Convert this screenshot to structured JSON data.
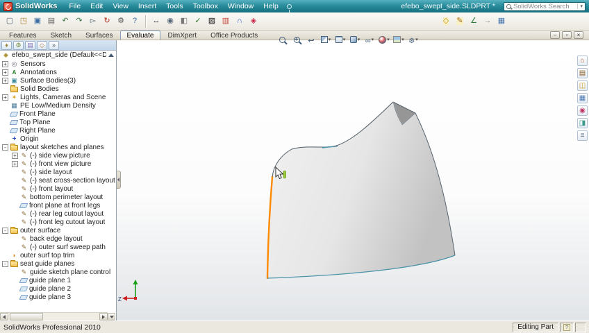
{
  "colors": {
    "titlebar": "#2a8d9c",
    "accent_orange": "#ff8a00",
    "edge_teal": "#4a93a8",
    "surface_light": "#f1f1f1",
    "surface_dark": "#c2c2c2",
    "flap_gray": "#969696",
    "toolbar_bg": "#ebe8e0",
    "status_bg": "#ebe8e0",
    "panel_header": "#d8e6f4"
  },
  "titlebar": {
    "app_name": "SolidWorks",
    "document_title": "efebo_swept_side.SLDPRT *",
    "search_placeholder": "SolidWorks Search",
    "menus": [
      {
        "label": "File",
        "name": "menu-file"
      },
      {
        "label": "Edit",
        "name": "menu-edit"
      },
      {
        "label": "View",
        "name": "menu-view"
      },
      {
        "label": "Insert",
        "name": "menu-insert"
      },
      {
        "label": "Tools",
        "name": "menu-tools"
      },
      {
        "label": "Toolbox",
        "name": "menu-toolbox"
      },
      {
        "label": "Window",
        "name": "menu-window"
      },
      {
        "label": "Help",
        "name": "menu-help"
      }
    ]
  },
  "toolbar": {
    "standard": [
      {
        "name": "new-button",
        "glyph": "▢",
        "fg": "#556677"
      },
      {
        "name": "open-button",
        "glyph": "◳",
        "fg": "#b08030"
      },
      {
        "name": "save-button",
        "glyph": "▣",
        "fg": "#3a6ea5"
      },
      {
        "name": "print-button",
        "glyph": "▤",
        "fg": "#666666"
      },
      {
        "name": "undo-button",
        "glyph": "↶",
        "fg": "#3a7a4a"
      },
      {
        "name": "redo-button",
        "glyph": "↷",
        "fg": "#3a7a4a"
      },
      {
        "name": "select-button",
        "glyph": "▻",
        "fg": "#556677"
      },
      {
        "name": "rebuild-button",
        "glyph": "↻",
        "fg": "#b03020"
      },
      {
        "name": "options-button",
        "glyph": "⚙",
        "fg": "#555555"
      },
      {
        "name": "help-button",
        "glyph": "?",
        "fg": "#3a6ea5"
      }
    ],
    "evaluate": [
      {
        "name": "measure-button",
        "glyph": "↔",
        "fg": "#333344"
      },
      {
        "name": "mass-properties-button",
        "glyph": "◉",
        "fg": "#556677"
      },
      {
        "name": "section-properties-button",
        "glyph": "◧",
        "fg": "#767676"
      },
      {
        "name": "check-entity-button",
        "glyph": "✓",
        "fg": "#2a7a2a"
      },
      {
        "name": "zebra-stripes-button",
        "glyph": "▨",
        "fg": "#111111"
      },
      {
        "name": "draft-analysis-button",
        "glyph": "▥",
        "fg": "#c04030"
      },
      {
        "name": "curvature-button",
        "glyph": "∩",
        "fg": "#3060c0"
      },
      {
        "name": "material-properties-button",
        "glyph": "◈",
        "fg": "#cc2244"
      }
    ],
    "sketch_group": [
      {
        "name": "reference-geometry-button",
        "glyph": "◇",
        "fg": "#b89010",
        "bg": "#faf0c4"
      },
      {
        "name": "sketch-button",
        "glyph": "✎",
        "fg": "#a06a20",
        "bg": "#faf0c4"
      },
      {
        "name": "smart-dimension-button",
        "glyph": "∠",
        "fg": "#2a7a3a"
      },
      {
        "name": "move-copy-button",
        "glyph": "→",
        "fg": "#888888"
      },
      {
        "name": "display-settings-button",
        "glyph": "▦",
        "fg": "#4a78b0"
      }
    ]
  },
  "command_tabs": [
    {
      "label": "Features",
      "name": "tab-features"
    },
    {
      "label": "Sketch",
      "name": "tab-sketch"
    },
    {
      "label": "Surfaces",
      "name": "tab-surfaces"
    },
    {
      "label": "Evaluate",
      "name": "tab-evaluate",
      "active": true
    },
    {
      "label": "DimXpert",
      "name": "tab-dimxpert"
    },
    {
      "label": "Office Products",
      "name": "tab-office-products"
    }
  ],
  "feature_tree": {
    "panel_tabs": [
      {
        "name": "featuremanager-tab",
        "glyph": "♦",
        "fg": "#9a8a3a"
      },
      {
        "name": "propertymanager-tab",
        "glyph": "⚙",
        "fg": "#6a8a3a"
      },
      {
        "name": "configurationmanager-tab",
        "glyph": "▤",
        "fg": "#7a6ab0"
      },
      {
        "name": "dimxpertmanager-tab",
        "glyph": "◇",
        "fg": "#b06a2a"
      },
      {
        "name": "panel-tabs-overflow",
        "glyph": "»",
        "fg": "#445566"
      }
    ],
    "root": "efebo_swept_side (Default<<Default>_Dis",
    "items": [
      {
        "label": "Sensors",
        "icon": "sensors",
        "indent": 0,
        "exp": "+"
      },
      {
        "label": "Annotations",
        "icon": "annotations",
        "indent": 0,
        "exp": "+"
      },
      {
        "label": "Surface Bodies(3)",
        "icon": "bodies",
        "indent": 0,
        "exp": "+"
      },
      {
        "label": "Solid Bodies",
        "icon": "folder",
        "indent": 0,
        "exp": ""
      },
      {
        "label": "Lights, Cameras and Scene",
        "icon": "lights",
        "indent": 0,
        "exp": "+"
      },
      {
        "label": "PE Low/Medium Density",
        "icon": "material",
        "indent": 0,
        "exp": ""
      },
      {
        "label": "Front Plane",
        "icon": "plane",
        "indent": 0,
        "exp": ""
      },
      {
        "label": "Top Plane",
        "icon": "plane",
        "indent": 0,
        "exp": ""
      },
      {
        "label": "Right Plane",
        "icon": "plane",
        "indent": 0,
        "exp": ""
      },
      {
        "label": "Origin",
        "icon": "origin",
        "indent": 0,
        "exp": ""
      },
      {
        "label": "layout sketches and planes",
        "icon": "folder",
        "indent": 0,
        "exp": "-"
      },
      {
        "label": "(-) side view picture",
        "icon": "sketch",
        "indent": 1,
        "exp": "+"
      },
      {
        "label": "(-) front view picture",
        "icon": "sketch",
        "indent": 1,
        "exp": "+"
      },
      {
        "label": "(-) side layout",
        "icon": "sketch",
        "indent": 1,
        "exp": ""
      },
      {
        "label": "(-) seat cross-section layout",
        "icon": "sketch",
        "indent": 1,
        "exp": ""
      },
      {
        "label": "(-) front layout",
        "icon": "sketch",
        "indent": 1,
        "exp": ""
      },
      {
        "label": "bottom perimeter layout",
        "icon": "sketch",
        "indent": 1,
        "exp": ""
      },
      {
        "label": "front plane at front legs",
        "icon": "plane",
        "indent": 1,
        "exp": ""
      },
      {
        "label": "(-) rear leg cutout layout",
        "icon": "sketch",
        "indent": 1,
        "exp": ""
      },
      {
        "label": "(-) front leg cutout layout",
        "icon": "sketch",
        "indent": 1,
        "exp": ""
      },
      {
        "label": "outer surface",
        "icon": "folder",
        "indent": 0,
        "exp": "-"
      },
      {
        "label": "back edge layout",
        "icon": "sketch",
        "indent": 1,
        "exp": ""
      },
      {
        "label": "(-) outer surf sweep path",
        "icon": "sketch",
        "indent": 1,
        "exp": ""
      },
      {
        "label": "outer surf top trim",
        "icon": "surface",
        "indent": 0,
        "exp": ""
      },
      {
        "label": "seat guide planes",
        "icon": "folder",
        "indent": 0,
        "exp": "-"
      },
      {
        "label": "guide sketch plane control",
        "icon": "sketch",
        "indent": 1,
        "exp": ""
      },
      {
        "label": "guide plane 1",
        "icon": "plane",
        "indent": 1,
        "exp": ""
      },
      {
        "label": "guide plane 2",
        "icon": "plane",
        "indent": 1,
        "exp": ""
      },
      {
        "label": "guide plane 3",
        "icon": "plane",
        "indent": 1,
        "exp": ""
      }
    ]
  },
  "viewbar": {
    "buttons": [
      {
        "name": "zoom-fit-button",
        "cls": "vi-mag"
      },
      {
        "name": "zoom-area-button",
        "cls": "vi-magp"
      },
      {
        "name": "previous-view-button",
        "cls": "vi-prev"
      },
      {
        "name": "section-view-button",
        "cls": "vi-section",
        "drop": true
      },
      {
        "name": "view-orientation-button",
        "cls": "vi-cube",
        "drop": true
      },
      {
        "name": "display-style-button",
        "cls": "vi-shaded",
        "drop": true
      },
      {
        "name": "hide-show-items-button",
        "cls": "vi-glasses",
        "drop": true
      },
      {
        "name": "edit-appearance-button",
        "cls": "vi-ball",
        "drop": true
      },
      {
        "name": "apply-scene-button",
        "cls": "vi-scene",
        "drop": true
      },
      {
        "name": "view-settings-button",
        "cls": "vi-gear",
        "drop": true
      }
    ],
    "window_controls": {
      "minimize": "–",
      "restore": "▫",
      "close": "×"
    }
  },
  "task_pane": [
    {
      "name": "solidworks-resources-button",
      "glyph": "⌂",
      "fg": "#b05020"
    },
    {
      "name": "design-library-button",
      "glyph": "▤",
      "fg": "#8a5a20"
    },
    {
      "name": "file-explorer-button",
      "glyph": "◫",
      "fg": "#c8a024"
    },
    {
      "name": "view-palette-button",
      "glyph": "▦",
      "fg": "#4a78b0"
    },
    {
      "name": "appearances-button",
      "glyph": "◉",
      "fg": "#c03060"
    },
    {
      "name": "scenes-button",
      "glyph": "◨",
      "fg": "#3a9a8a"
    },
    {
      "name": "custom-properties-button",
      "glyph": "≡",
      "fg": "#556677"
    }
  ],
  "viewport": {
    "triad_z": "Z"
  },
  "statusbar": {
    "left": "SolidWorks Professional 2010",
    "mode": "Editing Part"
  }
}
